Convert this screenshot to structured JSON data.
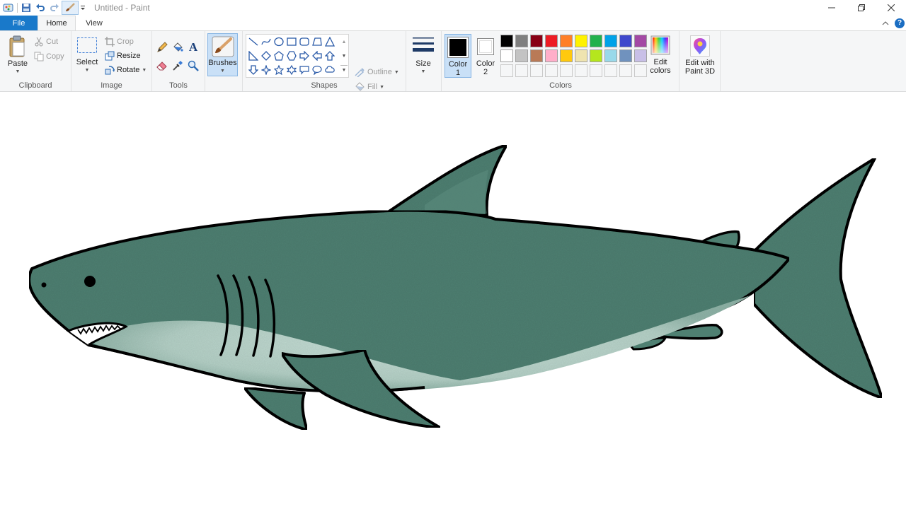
{
  "window": {
    "title": "Untitled - Paint"
  },
  "tabs": {
    "file": "File",
    "home": "Home",
    "view": "View"
  },
  "clipboard": {
    "group_label": "Clipboard",
    "paste": "Paste",
    "cut": "Cut",
    "copy": "Copy"
  },
  "image": {
    "group_label": "Image",
    "select": "Select",
    "crop": "Crop",
    "resize": "Resize",
    "rotate": "Rotate"
  },
  "tools": {
    "group_label": "Tools",
    "items": [
      "pencil-icon",
      "fill-icon",
      "text-icon",
      "eraser-icon",
      "color-picker-icon",
      "magnifier-icon"
    ]
  },
  "brushes": {
    "label": "Brushes"
  },
  "shapes": {
    "group_label": "Shapes",
    "outline": "Outline",
    "fill": "Fill"
  },
  "size": {
    "label": "Size"
  },
  "colors": {
    "group_label": "Colors",
    "color1_label": "Color\n1",
    "color1_line1": "Color",
    "color1_line2": "1",
    "color2_line1": "Color",
    "color2_line2": "2",
    "color1_value": "#000000",
    "color2_value": "#ffffff",
    "edit_colors_line1": "Edit",
    "edit_colors_line2": "colors",
    "edit_paint3d_line1": "Edit with",
    "edit_paint3d_line2": "Paint 3D",
    "palette_row1": [
      "#000000",
      "#7f7f7f",
      "#880015",
      "#ed1c24",
      "#ff7f27",
      "#fff200",
      "#22b14c",
      "#00a2e8",
      "#3f48cc",
      "#a349a4"
    ],
    "palette_row2": [
      "#ffffff",
      "#c3c3c3",
      "#b97a57",
      "#ffaec9",
      "#ffc90e",
      "#efe4b0",
      "#b5e61d",
      "#99d9ea",
      "#7092be",
      "#c8bfe7"
    ]
  },
  "drawing": {
    "subject": "shark",
    "body_color": "#4f8072",
    "belly_color": "#bcd6cd",
    "outline_color": "#000000"
  }
}
